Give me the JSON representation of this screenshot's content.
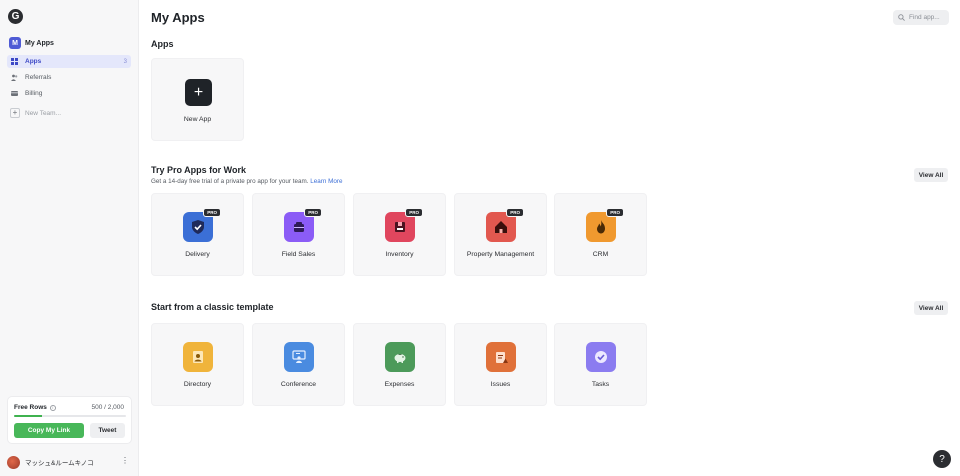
{
  "sidebar": {
    "logo": "G",
    "team": {
      "initial": "M",
      "name": "My Apps"
    },
    "items": [
      {
        "label": "Apps",
        "count": "3",
        "active": true,
        "icon": "grid-icon"
      },
      {
        "label": "Referrals",
        "icon": "people-icon"
      },
      {
        "label": "Billing",
        "icon": "card-icon"
      }
    ],
    "new_team_label": "New Team...",
    "free_rows": {
      "label": "Free Rows",
      "count": "500 / 2,000",
      "progress_fraction": 0.25,
      "copy_label": "Copy My Link",
      "tweet_label": "Tweet"
    },
    "user": {
      "name": "マッシュ&ルームキノコ"
    }
  },
  "main": {
    "title": "My Apps",
    "search_placeholder": "Find app...",
    "apps_section": {
      "title": "Apps",
      "new_app_label": "New App"
    },
    "pro_section": {
      "title": "Try Pro Apps for Work",
      "subtitle": "Get a 14-day free trial of a private pro app for your team.",
      "learn_more": "Learn More",
      "view_all": "View All",
      "badge": "PRO",
      "cards": [
        {
          "label": "Delivery",
          "icon": "delivery-icon",
          "color": "#3b6fd6"
        },
        {
          "label": "Field Sales",
          "icon": "field-sales-icon",
          "color": "#8b5cf6"
        },
        {
          "label": "Inventory",
          "icon": "inventory-icon",
          "color": "#e0465e"
        },
        {
          "label": "Property Management",
          "icon": "house-icon",
          "color": "#e2584f"
        },
        {
          "label": "CRM",
          "icon": "flame-icon",
          "color": "#f0992f"
        }
      ]
    },
    "template_section": {
      "title": "Start from a classic template",
      "view_all": "View All",
      "cards": [
        {
          "label": "Directory",
          "icon": "directory-icon",
          "color": "#f0b43b"
        },
        {
          "label": "Conference",
          "icon": "conference-icon",
          "color": "#4a8be0"
        },
        {
          "label": "Expenses",
          "icon": "piggy-bank-icon",
          "color": "#4c9a5a"
        },
        {
          "label": "Issues",
          "icon": "issues-icon",
          "color": "#e0713a"
        },
        {
          "label": "Tasks",
          "icon": "check-icon",
          "color": "#8b7cf0"
        }
      ]
    },
    "help_label": "?"
  }
}
